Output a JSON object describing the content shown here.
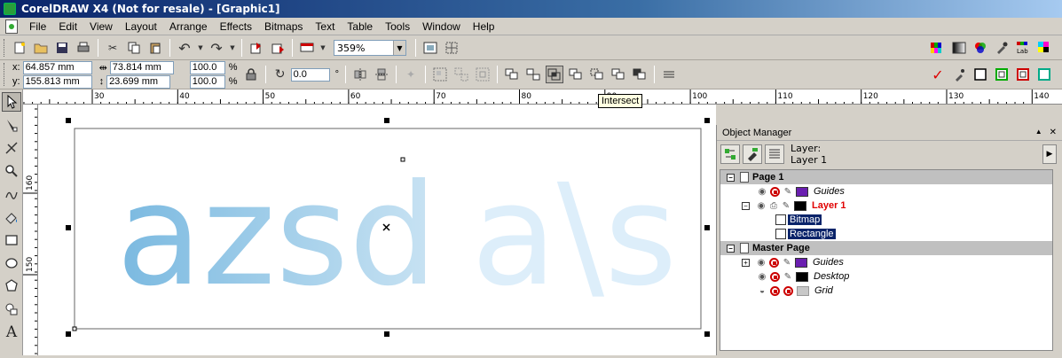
{
  "window": {
    "title": "CorelDRAW X4 (Not for resale) - [Graphic1]"
  },
  "menu": [
    "File",
    "Edit",
    "View",
    "Layout",
    "Arrange",
    "Effects",
    "Bitmaps",
    "Text",
    "Table",
    "Tools",
    "Window",
    "Help"
  ],
  "toolbar": {
    "zoom_value": "359%"
  },
  "property_bar": {
    "x_label": "x:",
    "x_value": "64.857 mm",
    "y_label": "y:",
    "y_value": "155.813 mm",
    "width_value": "73.814 mm",
    "height_value": "23.699 mm",
    "scale_x": "100.0",
    "scale_y": "100.0",
    "percent": "%",
    "rotation_value": "0.0",
    "degree": "°"
  },
  "rulers": {
    "top_ticks": [
      "30",
      "40",
      "50",
      "60",
      "70",
      "80",
      "90",
      "100",
      "110",
      "120",
      "130",
      "140"
    ],
    "left_ticks": [
      "160",
      "150"
    ]
  },
  "tooltip": "Intersect",
  "canvas": {
    "text_left": "azsd",
    "text_right": "a\\s",
    "colors": {
      "text_left_start": "#7ab9e0",
      "text_left_end": "#c9e3f3",
      "text_right": "#ddeefa"
    }
  },
  "object_manager": {
    "title": "Object Manager",
    "close": "✕",
    "layer_label": "Layer:",
    "layer_name": "Layer 1",
    "tree": {
      "page1": "Page 1",
      "guides": "Guides",
      "layer1": "Layer 1",
      "bitmap": "Bitmap",
      "rectangle": "Rectangle",
      "master_page": "Master Page",
      "master_guides": "Guides",
      "desktop": "Desktop",
      "grid": "Grid"
    },
    "colors": {
      "guides": "#6a1fb0",
      "layer": "#000000",
      "grid": "#c8c8c8",
      "layer_text": "#e00000"
    }
  }
}
